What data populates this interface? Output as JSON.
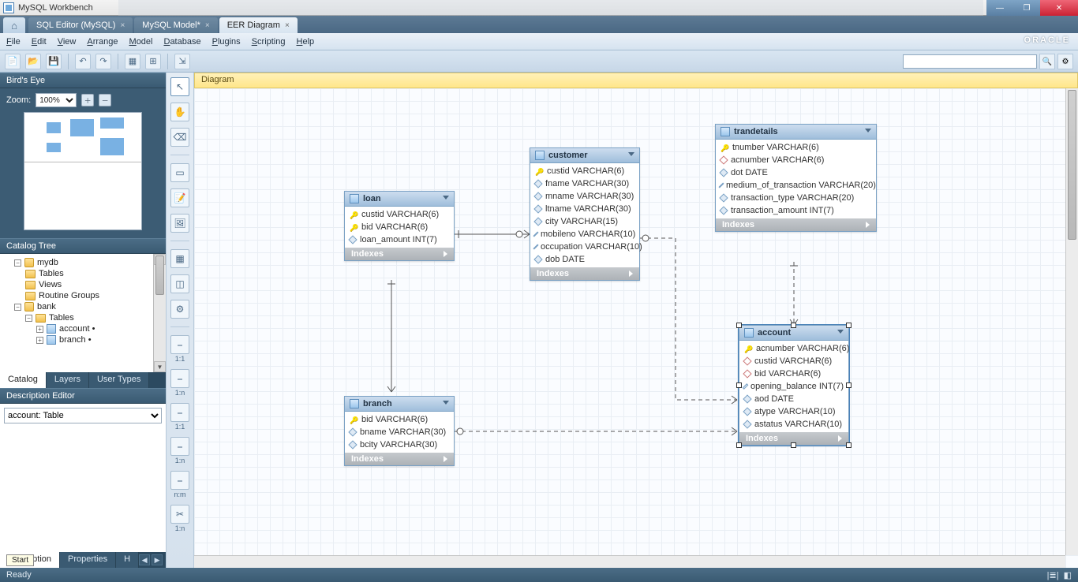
{
  "app": {
    "title": "MySQL Workbench"
  },
  "doctabs": [
    {
      "label": "SQL Editor (MySQL)",
      "active": false
    },
    {
      "label": "MySQL Model*",
      "active": false
    },
    {
      "label": "EER Diagram",
      "active": true
    }
  ],
  "menu": [
    "File",
    "Edit",
    "View",
    "Arrange",
    "Model",
    "Database",
    "Plugins",
    "Scripting",
    "Help"
  ],
  "oracle": "ORACLE",
  "diagram_header": "Diagram",
  "birdseye": {
    "title": "Bird's Eye",
    "zoom_label": "Zoom:",
    "zoom_value": "100%"
  },
  "catalog": {
    "title": "Catalog Tree",
    "tree": {
      "mydb": "mydb",
      "mydb_children": [
        "Tables",
        "Views",
        "Routine Groups"
      ],
      "bank": "bank",
      "bank_tables": "Tables",
      "bank_table_items": [
        "account •",
        "branch •"
      ]
    },
    "tabs": [
      "Catalog",
      "Layers",
      "User Types"
    ]
  },
  "description": {
    "title": "Description Editor",
    "value": "account: Table",
    "bottom_tabs": [
      "Description",
      "Properties",
      "H"
    ]
  },
  "tools_rel": [
    "1:1",
    "1:n",
    "1:1",
    "1:n",
    "n:m",
    "1:n"
  ],
  "entities": {
    "loan": {
      "name": "loan",
      "cols": [
        {
          "k": "pk",
          "t": "custid VARCHAR(6)"
        },
        {
          "k": "pk",
          "t": "bid VARCHAR(6)"
        },
        {
          "k": "attr",
          "t": "loan_amount INT(7)"
        }
      ],
      "idx": "Indexes"
    },
    "customer": {
      "name": "customer",
      "cols": [
        {
          "k": "pk",
          "t": "custid VARCHAR(6)"
        },
        {
          "k": "attr",
          "t": "fname VARCHAR(30)"
        },
        {
          "k": "attr",
          "t": "mname VARCHAR(30)"
        },
        {
          "k": "attr",
          "t": "ltname VARCHAR(30)"
        },
        {
          "k": "attr",
          "t": "city VARCHAR(15)"
        },
        {
          "k": "attr",
          "t": "mobileno VARCHAR(10)"
        },
        {
          "k": "attr",
          "t": "occupation VARCHAR(10)"
        },
        {
          "k": "attr",
          "t": "dob DATE"
        }
      ],
      "idx": "Indexes"
    },
    "trandetails": {
      "name": "trandetails",
      "cols": [
        {
          "k": "pk",
          "t": "tnumber VARCHAR(6)"
        },
        {
          "k": "fk",
          "t": "acnumber VARCHAR(6)"
        },
        {
          "k": "attr",
          "t": "dot DATE"
        },
        {
          "k": "attr",
          "t": "medium_of_transaction VARCHAR(20)"
        },
        {
          "k": "attr",
          "t": "transaction_type VARCHAR(20)"
        },
        {
          "k": "attr",
          "t": "transaction_amount INT(7)"
        }
      ],
      "idx": "Indexes"
    },
    "branch": {
      "name": "branch",
      "cols": [
        {
          "k": "pk",
          "t": "bid VARCHAR(6)"
        },
        {
          "k": "attr",
          "t": "bname VARCHAR(30)"
        },
        {
          "k": "attr",
          "t": "bcity VARCHAR(30)"
        }
      ],
      "idx": "Indexes"
    },
    "account": {
      "name": "account",
      "cols": [
        {
          "k": "pk",
          "t": "acnumber VARCHAR(6)"
        },
        {
          "k": "fk",
          "t": "custid VARCHAR(6)"
        },
        {
          "k": "fk",
          "t": "bid VARCHAR(6)"
        },
        {
          "k": "attr",
          "t": "opening_balance INT(7)"
        },
        {
          "k": "attr",
          "t": "aod DATE"
        },
        {
          "k": "attr",
          "t": "atype VARCHAR(10)"
        },
        {
          "k": "attr",
          "t": "astatus VARCHAR(10)"
        }
      ],
      "idx": "Indexes"
    }
  },
  "status": {
    "left": "Ready",
    "tip": "Start"
  }
}
